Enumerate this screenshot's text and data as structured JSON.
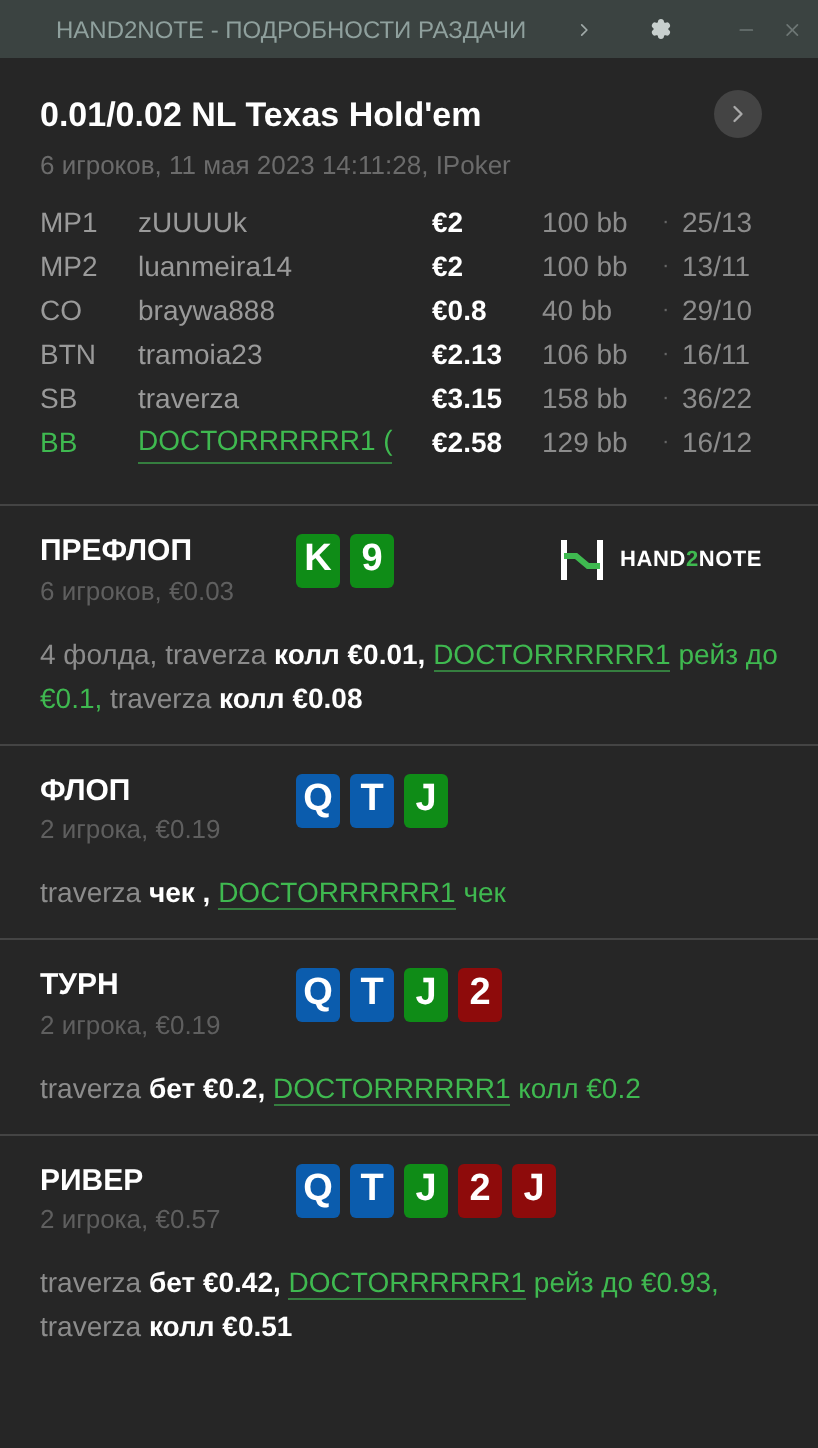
{
  "window": {
    "title": "HAND2NOTE - ПОДРОБНОСТИ РАЗДАЧИ"
  },
  "hand": {
    "title": "0.01/0.02 NL Texas Hold'em",
    "subtitle": "6 игроков, 11 мая 2023 14:11:28, IPoker"
  },
  "players": [
    {
      "position": "MP1",
      "name": "zUUUUk",
      "stack": "€2",
      "bb": "100 bb",
      "separator": "·",
      "stats": "25/13",
      "hero": false
    },
    {
      "position": "MP2",
      "name": "luanmeira14",
      "stack": "€2",
      "bb": "100 bb",
      "separator": "·",
      "stats": "13/11",
      "hero": false
    },
    {
      "position": "CO",
      "name": "braywa888",
      "stack": "€0.8",
      "bb": "40 bb",
      "separator": "·",
      "stats": "29/10",
      "hero": false
    },
    {
      "position": "BTN",
      "name": "tramoia23",
      "stack": "€2.13",
      "bb": "106 bb",
      "separator": "·",
      "stats": "16/11",
      "hero": false
    },
    {
      "position": "SB",
      "name": "traverza",
      "stack": "€3.15",
      "bb": "158 bb",
      "separator": "·",
      "stats": "36/22",
      "hero": false
    },
    {
      "position": "BB",
      "name": "DOCTORRRRRR1 (",
      "stack": "€2.58",
      "bb": "129 bb",
      "separator": "·",
      "stats": "16/12",
      "hero": true
    }
  ],
  "logo": {
    "text_start": "HAND",
    "text_mid": "2",
    "text_end": "NOTE"
  },
  "streets": [
    {
      "name": "ПРЕФЛОП",
      "info": "6 игроков, €0.03",
      "logo": true,
      "cards": [
        {
          "rank": "K",
          "color": "#0f8c17"
        },
        {
          "rank": "9",
          "color": "#0f8c17"
        }
      ],
      "actions": [
        {
          "kind": "player",
          "text": "4 фолда, traverza "
        },
        {
          "kind": "action",
          "text": "колл €0.01, "
        },
        {
          "kind": "hero",
          "text": "DOCTORRRRRR1"
        },
        {
          "kind": "hero_action",
          "text": " рейз до €0.1, "
        },
        {
          "kind": "player",
          "text": "traverza "
        },
        {
          "kind": "action",
          "text": "колл €0.08"
        }
      ]
    },
    {
      "name": "ФЛОП",
      "info": "2 игрока, €0.19",
      "logo": false,
      "cards": [
        {
          "rank": "Q",
          "color": "#0b5cad"
        },
        {
          "rank": "T",
          "color": "#0b5cad"
        },
        {
          "rank": "J",
          "color": "#0f8c17"
        }
      ],
      "actions": [
        {
          "kind": "player",
          "text": "traverza "
        },
        {
          "kind": "action",
          "text": "чек , "
        },
        {
          "kind": "hero",
          "text": "DOCTORRRRRR1"
        },
        {
          "kind": "hero_action",
          "text": " чек"
        }
      ]
    },
    {
      "name": "ТУРН",
      "info": "2 игрока, €0.19",
      "logo": false,
      "cards": [
        {
          "rank": "Q",
          "color": "#0b5cad"
        },
        {
          "rank": "T",
          "color": "#0b5cad"
        },
        {
          "rank": "J",
          "color": "#0f8c17"
        },
        {
          "rank": "2",
          "color": "#8e0b0b"
        }
      ],
      "actions": [
        {
          "kind": "player",
          "text": "traverza "
        },
        {
          "kind": "action",
          "text": "бет €0.2, "
        },
        {
          "kind": "hero",
          "text": "DOCTORRRRRR1"
        },
        {
          "kind": "hero_action",
          "text": " колл €0.2"
        }
      ]
    },
    {
      "name": "РИВЕР",
      "info": "2 игрока, €0.57",
      "logo": false,
      "cards": [
        {
          "rank": "Q",
          "color": "#0b5cad"
        },
        {
          "rank": "T",
          "color": "#0b5cad"
        },
        {
          "rank": "J",
          "color": "#0f8c17"
        },
        {
          "rank": "2",
          "color": "#8e0b0b"
        },
        {
          "rank": "J",
          "color": "#8e0b0b"
        }
      ],
      "actions": [
        {
          "kind": "player",
          "text": "traverza "
        },
        {
          "kind": "action",
          "text": "бет €0.42, "
        },
        {
          "kind": "hero",
          "text": "DOCTORRRRRR1"
        },
        {
          "kind": "hero_action",
          "text": " рейз до €0.93, "
        },
        {
          "kind": "player",
          "text": "traverza "
        },
        {
          "kind": "action",
          "text": "колл €0.51"
        }
      ]
    }
  ]
}
